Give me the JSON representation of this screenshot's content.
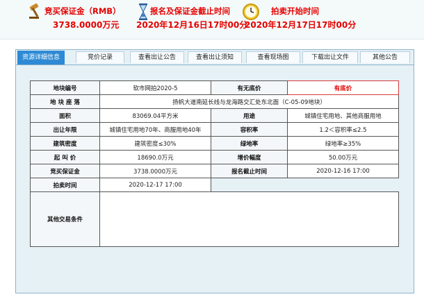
{
  "summary": {
    "deposit": {
      "label": "竞买保证金（RMB）",
      "value": "3738.0000万元"
    },
    "deadline": {
      "label": "报名及保证金截止时间",
      "value": "2020年12月16日17时00分"
    },
    "auction_start": {
      "label": "拍卖开始时间",
      "value": "2020年12月17日17时00分"
    }
  },
  "tabs": [
    {
      "label": "资源详细信息",
      "active": true
    },
    {
      "label": "竞价记录",
      "active": false
    },
    {
      "label": "查看出让公告",
      "active": false
    },
    {
      "label": "查看出让须知",
      "active": false
    },
    {
      "label": "查看现场图",
      "active": false
    },
    {
      "label": "下载出让文件",
      "active": false
    },
    {
      "label": "其他公告",
      "active": false
    }
  ],
  "table": {
    "plot_no_label": "地块编号",
    "plot_no": "软市网拍2020-5",
    "reserve_label": "有无底价",
    "reserve": "有底价",
    "location_label": "地 块 座 落",
    "location": "扬帆大道南延长线与龙海路交汇处东北面（C-05-09地块）",
    "area_label": "面积",
    "area": "83069.04平方米",
    "use_label": "用途",
    "use": "城镇住宅用地、其他商服用地",
    "term_label": "出让年限",
    "term": "城镇住宅用地70年、商服用地40年",
    "far_label": "容积率",
    "far": "1.2＜容积率≤2.5",
    "density_label": "建筑密度",
    "density": "建筑密度≤30%",
    "green_label": "绿地率",
    "green": "绿地率≥35%",
    "start_price_label": "起 叫 价",
    "start_price": "18690.0万元",
    "increment_label": "增价幅度",
    "increment": "50.00万元",
    "deposit_label": "竞买保证金",
    "deposit": "3738.0000万元",
    "reg_deadline_label": "报名截止时间",
    "reg_deadline": "2020-12-16 17:00",
    "auction_time_label": "拍卖时间",
    "auction_time": "2020-12-17 17:00",
    "other_terms_label": "其他交易条件",
    "other_terms": ""
  },
  "colors": {
    "accent_red": "#e60000",
    "tab_active": "#2e8ad4",
    "frame_border": "#8bb2c9"
  }
}
